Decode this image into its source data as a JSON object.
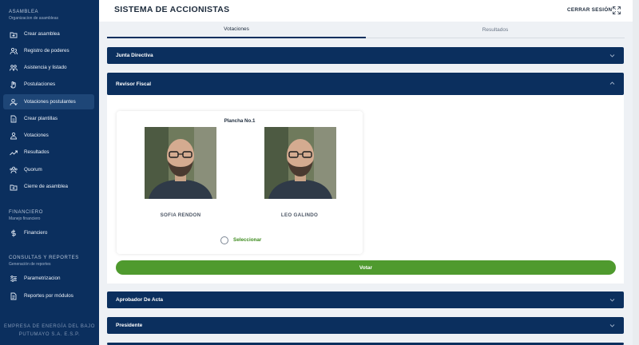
{
  "sidebar": {
    "sections": [
      {
        "title": "ASAMBLEA",
        "subtitle": "Organizacion de asambleas"
      },
      {
        "title": "FINANCIERO",
        "subtitle": "Manejo financiero"
      },
      {
        "title": "CONSULTAS Y REPORTES",
        "subtitle": "Generación de reportes"
      }
    ],
    "items": [
      {
        "label": "Crear asamblea",
        "icon": "folder-add-icon"
      },
      {
        "label": "Registro de poderes",
        "icon": "users-icon"
      },
      {
        "label": "Asistencia y listado",
        "icon": "people-icon"
      },
      {
        "label": "Postulaciones",
        "icon": "hand-icon"
      },
      {
        "label": "Votaciones postulantes",
        "icon": "user-check-icon",
        "active": true
      },
      {
        "label": "Crear plantillas",
        "icon": "document-icon"
      },
      {
        "label": "Votaciones",
        "icon": "vote-icon"
      },
      {
        "label": "Resultados",
        "icon": "trend-icon"
      },
      {
        "label": "Quorum",
        "icon": "group-icon"
      },
      {
        "label": "Cierre de asamblea",
        "icon": "folder-close-icon"
      },
      {
        "label": "Financiero",
        "icon": "dollar-icon"
      },
      {
        "label": "Parametrizacion",
        "icon": "sliders-icon"
      },
      {
        "label": "Reportes por módulos",
        "icon": "report-icon"
      }
    ],
    "company": "EMPRESA DE ENERGÍA DEL BAJO PUTUMAYO S.A. E.S.P."
  },
  "header": {
    "title": "SISTEMA DE ACCIONISTAS",
    "logout": "CERRAR SESIÓN"
  },
  "tabs": [
    {
      "label": "Votaciones",
      "active": true
    },
    {
      "label": "Resultados",
      "active": false
    }
  ],
  "accordions": [
    {
      "title": "Junta Directiva",
      "expanded": false
    },
    {
      "title": "Revisor Fiscal",
      "expanded": true
    },
    {
      "title": "Aprobador De Acta",
      "expanded": false
    },
    {
      "title": "Presidente",
      "expanded": false
    }
  ],
  "plancha": {
    "title": "Plancha No.1",
    "candidates": [
      {
        "name": "SOFIA RENDON"
      },
      {
        "name": "LEO GALINDO"
      }
    ],
    "select_label": "Seleccionar"
  },
  "vote_button": "Votar",
  "colors": {
    "sidebar": "#0b2f5e",
    "accent_green": "#4f9a2e"
  }
}
